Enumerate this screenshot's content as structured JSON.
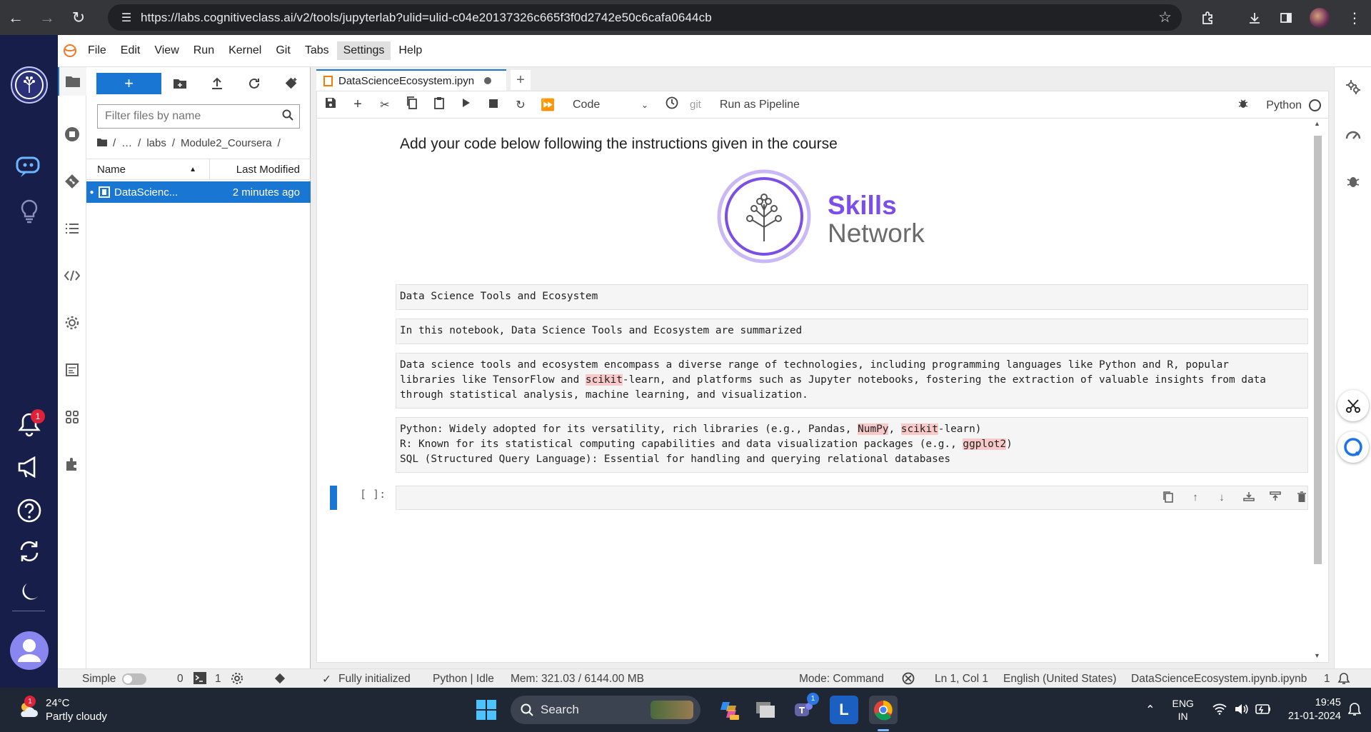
{
  "browser": {
    "url": "https://labs.cognitiveclass.ai/v2/tools/jupyterlab?ulid=ulid-c04e20137326c665f3f0d2742e50c6cafa0644cb"
  },
  "menubar": {
    "items": [
      "File",
      "Edit",
      "View",
      "Run",
      "Kernel",
      "Git",
      "Tabs",
      "Settings",
      "Help"
    ],
    "active": "Settings"
  },
  "rail": {
    "notification_count": "1"
  },
  "filebrowser": {
    "new_label": "+",
    "filter_placeholder": "Filter files by name",
    "breadcrumbs": [
      "/",
      "…",
      "/",
      "labs",
      "/",
      "Module2_Coursera",
      "/"
    ],
    "col_name": "Name",
    "col_modified": "Last Modified",
    "files": [
      {
        "name": "DataScienc...",
        "modified": "2 minutes ago"
      }
    ]
  },
  "notebook": {
    "tab_title": "DataScienceEcosystem.ipyn",
    "cell_type": "Code",
    "git_label": "git",
    "pipeline_label": "Run as Pipeline",
    "kernel_name": "Python",
    "heading": "Add your code below following the instructions given in the course",
    "logo": {
      "line1": "Skills",
      "line2": "Network"
    },
    "cells": {
      "c1": "Data Science Tools and Ecosystem",
      "c2": "In this notebook, Data Science Tools and Ecosystem are summarized",
      "c3_a": "Data science tools and ecosystem encompass a diverse range of technologies, including programming languages like Python and R, popular\nlibraries like TensorFlow and ",
      "c3_hl": "scikit",
      "c3_b": "-learn, and platforms such as Jupyter notebooks, fostering the extraction of valuable insights from data\nthrough statistical analysis, machine learning, and visualization.",
      "c4_a": "Python: Widely adopted for its versatility, rich libraries (e.g., Pandas, ",
      "c4_hl1": "NumPy",
      "c4_b": ", ",
      "c4_hl2": "scikit",
      "c4_c": "-learn)\nR: Known for its statistical computing capabilities and data visualization packages (e.g., ",
      "c4_hl3": "ggplot2",
      "c4_d": ")\nSQL (Structured Query Language): Essential for handling and querying relational databases"
    },
    "prompt": "[ ]:"
  },
  "statusbar": {
    "mode_simple": "Simple",
    "terminals": "0",
    "kernels": "1",
    "init": "Fully initialized",
    "kernel_status": "Python | Idle",
    "mem": "Mem: 321.03 / 6144.00 MB",
    "mode": "Mode: Command",
    "cursor": "Ln 1, Col 1",
    "language": "English (United States)",
    "filename": "DataScienceEcosystem.ipynb.ipynb",
    "notif_count": "1"
  },
  "taskbar": {
    "weather_temp": "24°C",
    "weather_desc": "Partly cloudy",
    "weather_badge": "1",
    "search_label": "Search",
    "teams_badge": "1",
    "lang_top": "ENG",
    "lang_bottom": "IN",
    "time": "19:45",
    "date": "21-01-2024"
  },
  "colors": {
    "jlab_blue": "#1976d2",
    "rail_bg": "#181e4a",
    "skills_purple": "#7b4ee8",
    "highlight": "#f9c9c9"
  }
}
